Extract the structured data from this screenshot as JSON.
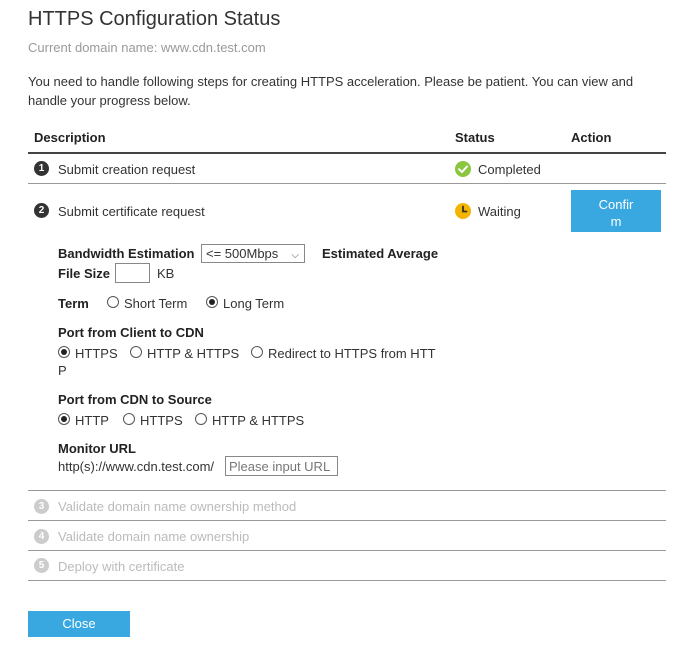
{
  "dialog": {
    "title": "HTTPS Configuration Status",
    "subtitle": "Current domain name: www.cdn.test.com",
    "intro": "You need to handle following steps for creating HTTPS acceleration. Please be patient. You can view and handle your progress below."
  },
  "table": {
    "col_description": "Description",
    "col_status": "Status",
    "col_action": "Action"
  },
  "steps": [
    {
      "num": "1",
      "label": "Submit creation request",
      "status": "Completed"
    },
    {
      "num": "2",
      "label": "Submit certificate request",
      "status": "Waiting",
      "action": "Confir\nm"
    },
    {
      "num": "3",
      "label": "Validate domain name ownership method"
    },
    {
      "num": "4",
      "label": "Validate domain name ownership"
    },
    {
      "num": "5",
      "label": "Deploy with certificate"
    }
  ],
  "form": {
    "bandwidth_label": "Bandwidth Estimation",
    "bandwidth_value": "<= 500Mbps",
    "estimated_label": "Estimated Average",
    "filesize_label": "File Size",
    "filesize_unit": "KB",
    "term_label": "Term",
    "term_options": [
      "Short Term",
      "Long Term"
    ],
    "term_selected": "Long Term",
    "port_client_label": "Port from Client to CDN",
    "port_client_options": [
      "HTTPS",
      "HTTP & HTTPS",
      "Redirect to HTTPS from HTT",
      "P"
    ],
    "port_client_selected": "HTTPS",
    "port_source_label": "Port from CDN to Source",
    "port_source_options": [
      "HTTP",
      "HTTPS",
      "HTTP & HTTPS"
    ],
    "port_source_selected": "HTTP",
    "monitor_label": "Monitor URL",
    "monitor_prefix": "http(s)://www.cdn.test.com/",
    "monitor_placeholder": "Please input URL"
  },
  "footer": {
    "close_label": "Close"
  },
  "colors": {
    "accent": "#39a8e0",
    "completed": "#8cc63f",
    "waiting": "#f5b400"
  }
}
